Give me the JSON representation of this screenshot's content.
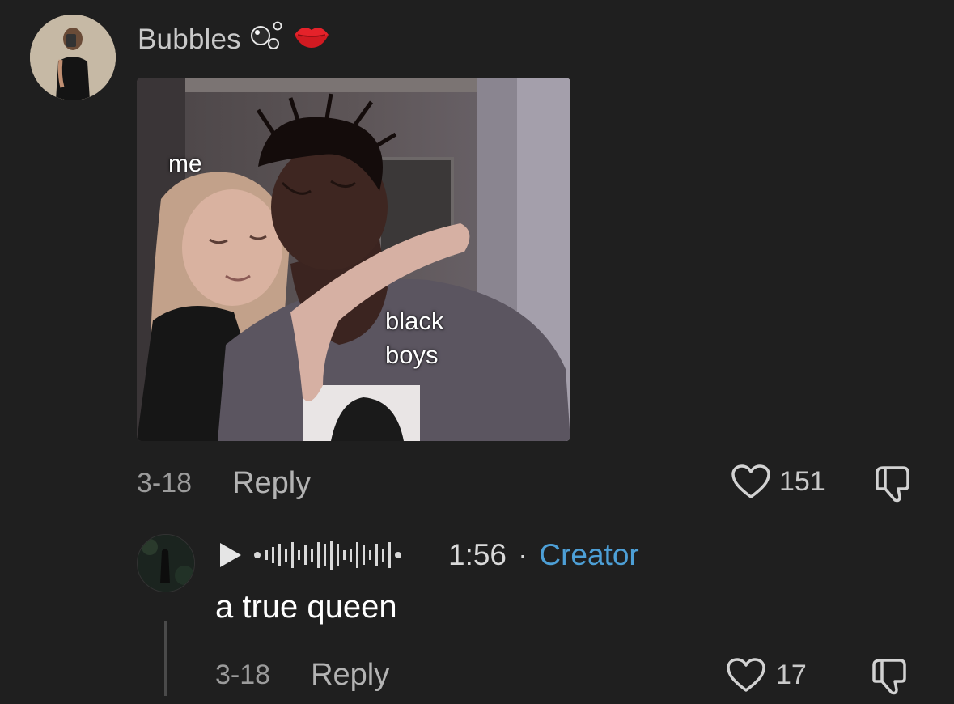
{
  "comment": {
    "username": "Bubbles",
    "username_emojis": [
      "bubbles-emoji",
      "kiss-lips-emoji"
    ],
    "image": {
      "overlay_texts": {
        "me": "me",
        "black_line1": "black",
        "black_line2": "boys"
      }
    },
    "date": "3-18",
    "reply_label": "Reply",
    "like_count": "151",
    "icons": {
      "like": "heart-icon",
      "dislike": "thumbs-down-icon"
    }
  },
  "reply": {
    "voice": {
      "icon": "play-icon",
      "duration": "1:56",
      "separator": "·",
      "badge": "Creator"
    },
    "text": "a true queen",
    "date": "3-18",
    "reply_label": "Reply",
    "like_count": "17",
    "icons": {
      "like": "heart-icon",
      "dislike": "thumbs-down-icon"
    }
  },
  "colors": {
    "background": "#1f1f1f",
    "creator_badge": "#4d9fd6",
    "muted_text": "#9b9b9b"
  }
}
